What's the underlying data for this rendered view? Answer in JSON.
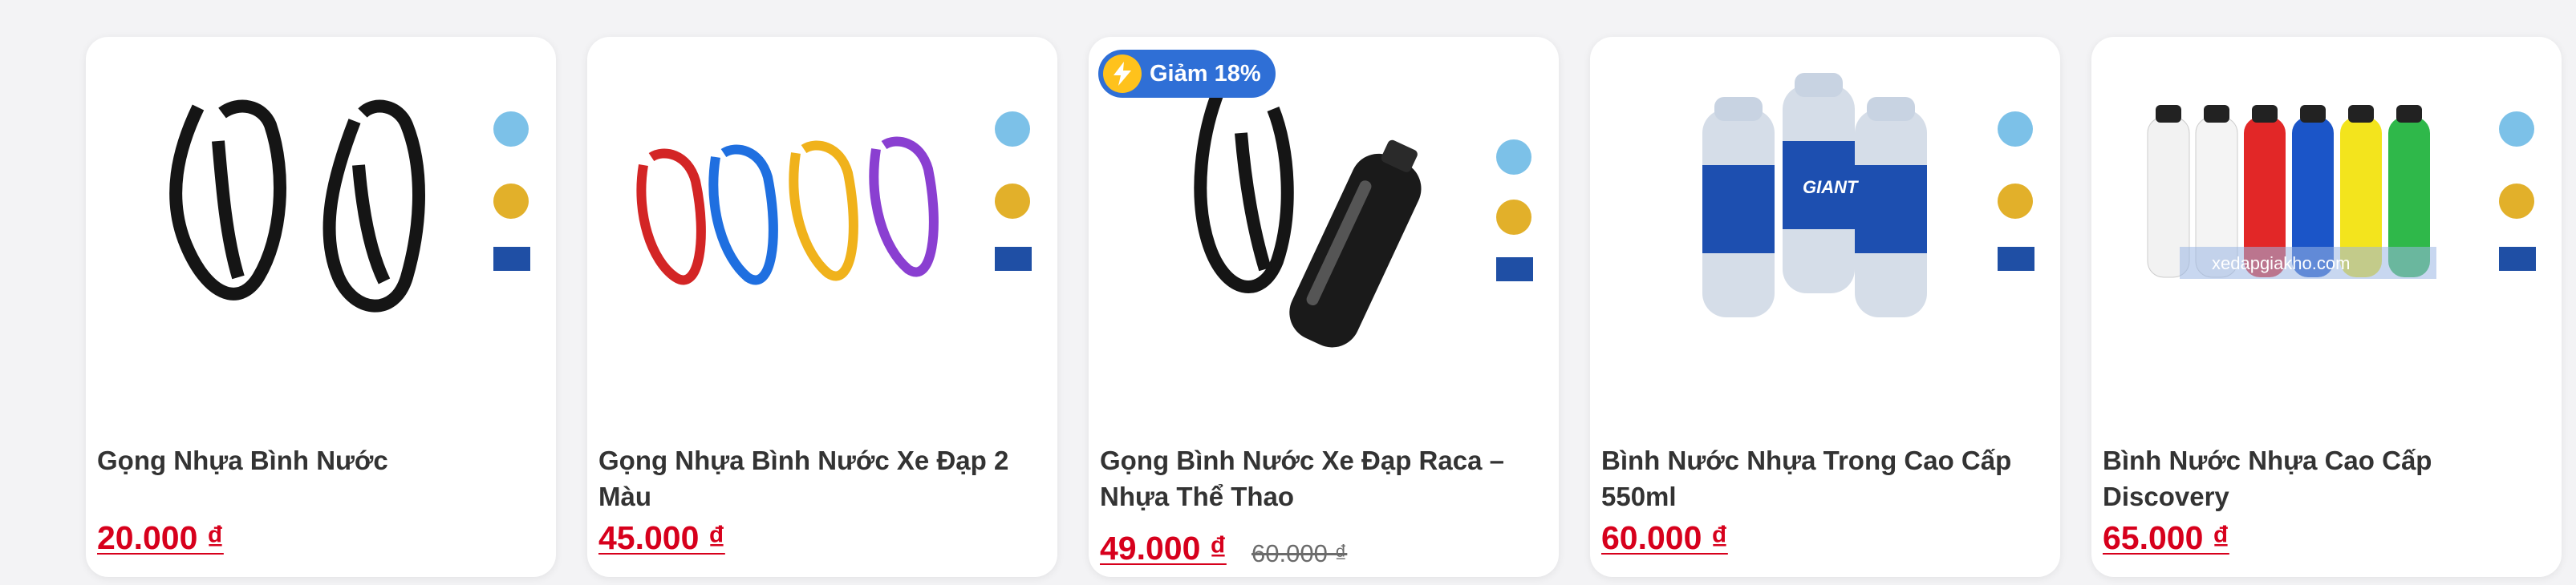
{
  "products": [
    {
      "name": "Gọng Nhựa Bình Nước",
      "price": "20.000 ₫"
    },
    {
      "name": "Gọng Nhựa Bình Nước Xe Đạp 2 Màu",
      "price": "45.000 ₫"
    },
    {
      "name": "Gọng Bình Nước Xe Đạp Raca – Nhựa Thể Thao",
      "price": "49.000 ₫",
      "old_price": "60.000 ₫",
      "badge": "Giảm 18%"
    },
    {
      "name": "Bình Nước Nhựa Trong Cao Cấp 550ml",
      "price": "60.000 ₫",
      "bottle_brand": "GIANT"
    },
    {
      "name": "Bình Nước Nhựa Cao Cấp Discovery",
      "price": "65.000 ₫",
      "watermark": "xedapgiakho.com"
    }
  ],
  "colors": {
    "price": "#d7001c",
    "badge": "#2f6fd6",
    "bolt": "#ffc21c",
    "text": "#333333"
  }
}
